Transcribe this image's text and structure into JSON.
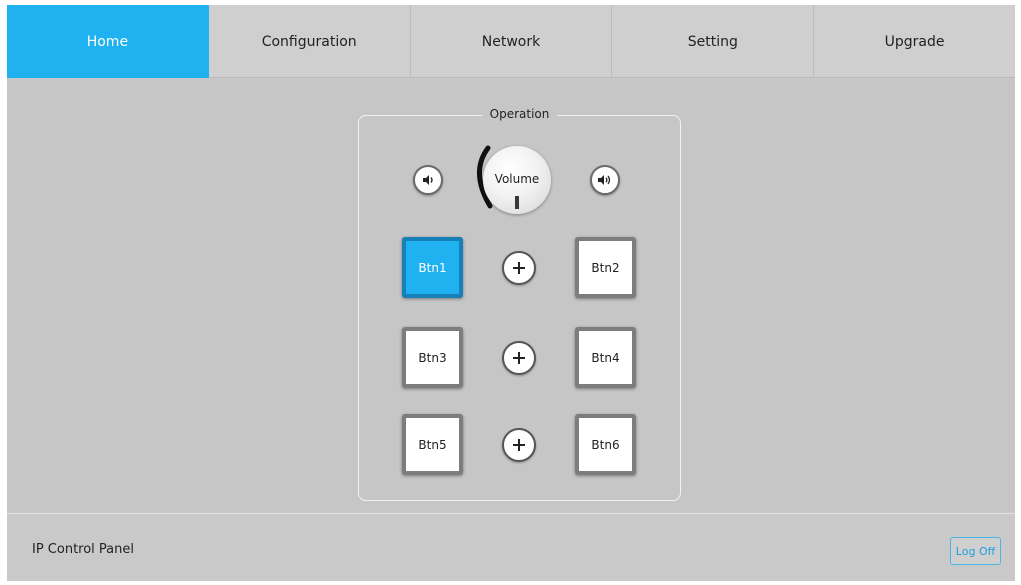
{
  "nav": {
    "tabs": [
      {
        "label": "Home",
        "active": true
      },
      {
        "label": "Configuration",
        "active": false
      },
      {
        "label": "Network",
        "active": false
      },
      {
        "label": "Setting",
        "active": false
      },
      {
        "label": "Upgrade",
        "active": false
      }
    ]
  },
  "operation": {
    "title": "Operation",
    "volume": {
      "label": "Volume",
      "down_icon": "speaker-low-icon",
      "up_icon": "speaker-high-icon"
    },
    "buttons": [
      {
        "label": "Btn1",
        "active": true
      },
      {
        "label": "Btn2",
        "active": false
      },
      {
        "label": "Btn3",
        "active": false
      },
      {
        "label": "Btn4",
        "active": false
      },
      {
        "label": "Btn5",
        "active": false
      },
      {
        "label": "Btn6",
        "active": false
      }
    ],
    "plus_icon": "plus-icon"
  },
  "footer": {
    "title": "IP Control Panel",
    "logoff_label": "Log Off"
  },
  "colors": {
    "accent": "#1fb1f0",
    "background": "#c9c9c9"
  }
}
